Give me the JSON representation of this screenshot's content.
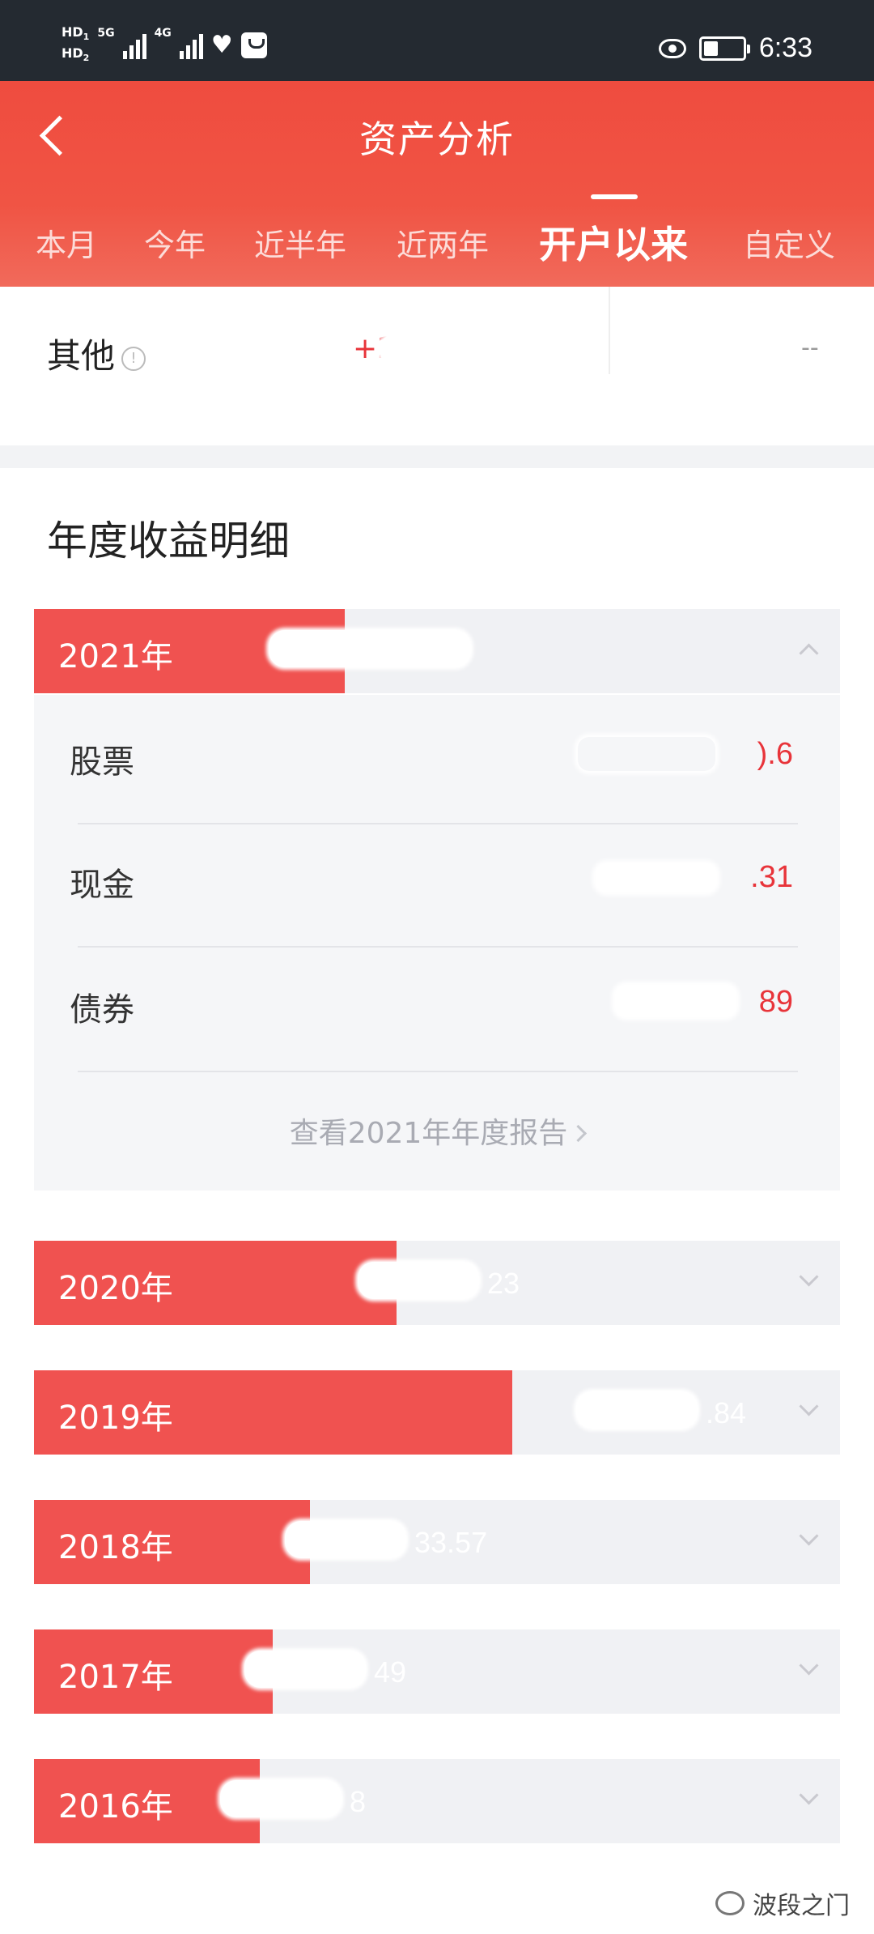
{
  "status_bar": {
    "sim1": "HD",
    "sim1_index": "1",
    "sim2": "HD",
    "sim2_index": "2",
    "network1": "5G",
    "network2": "4G",
    "time": "6:33",
    "icons": [
      "signal-icon",
      "heart-icon",
      "shopping-bag-icon",
      "eye-icon",
      "battery-icon"
    ]
  },
  "header": {
    "title": "资产分析",
    "tabs": [
      {
        "label": "本月",
        "active": false
      },
      {
        "label": "今年",
        "active": false
      },
      {
        "label": "近半年",
        "active": false
      },
      {
        "label": "近两年",
        "active": false
      },
      {
        "label": "开户以来",
        "active": true
      },
      {
        "label": "自定义",
        "active": false
      }
    ]
  },
  "other_row": {
    "label": "其他",
    "info": "!",
    "value": "+2",
    "secondary_value": "--"
  },
  "annual": {
    "title": "年度收益明细",
    "accent_color": "#f05250",
    "years": [
      {
        "year_label": "2021年",
        "value_suffix": "",
        "fill": 0.386,
        "expanded": true
      },
      {
        "year_label": "2020年",
        "value_suffix": "23",
        "fill": 0.45,
        "expanded": false
      },
      {
        "year_label": "2019年",
        "value_suffix": ".84",
        "fill": 0.593,
        "expanded": false
      },
      {
        "year_label": "2018年",
        "value_suffix": "33.57",
        "fill": 0.342,
        "expanded": false
      },
      {
        "year_label": "2017年",
        "value_suffix": "49",
        "fill": 0.296,
        "expanded": false
      },
      {
        "year_label": "2016年",
        "value_suffix": "8",
        "fill": 0.28,
        "expanded": false
      }
    ],
    "detail_2021": {
      "rows": [
        {
          "label": "股票",
          "value_suffix": ").6"
        },
        {
          "label": "现金",
          "value_suffix": ".31"
        },
        {
          "label": "债券",
          "value_suffix": "89"
        }
      ],
      "report_link": "查看2021年年度报告"
    }
  },
  "watermark": "波段之门"
}
